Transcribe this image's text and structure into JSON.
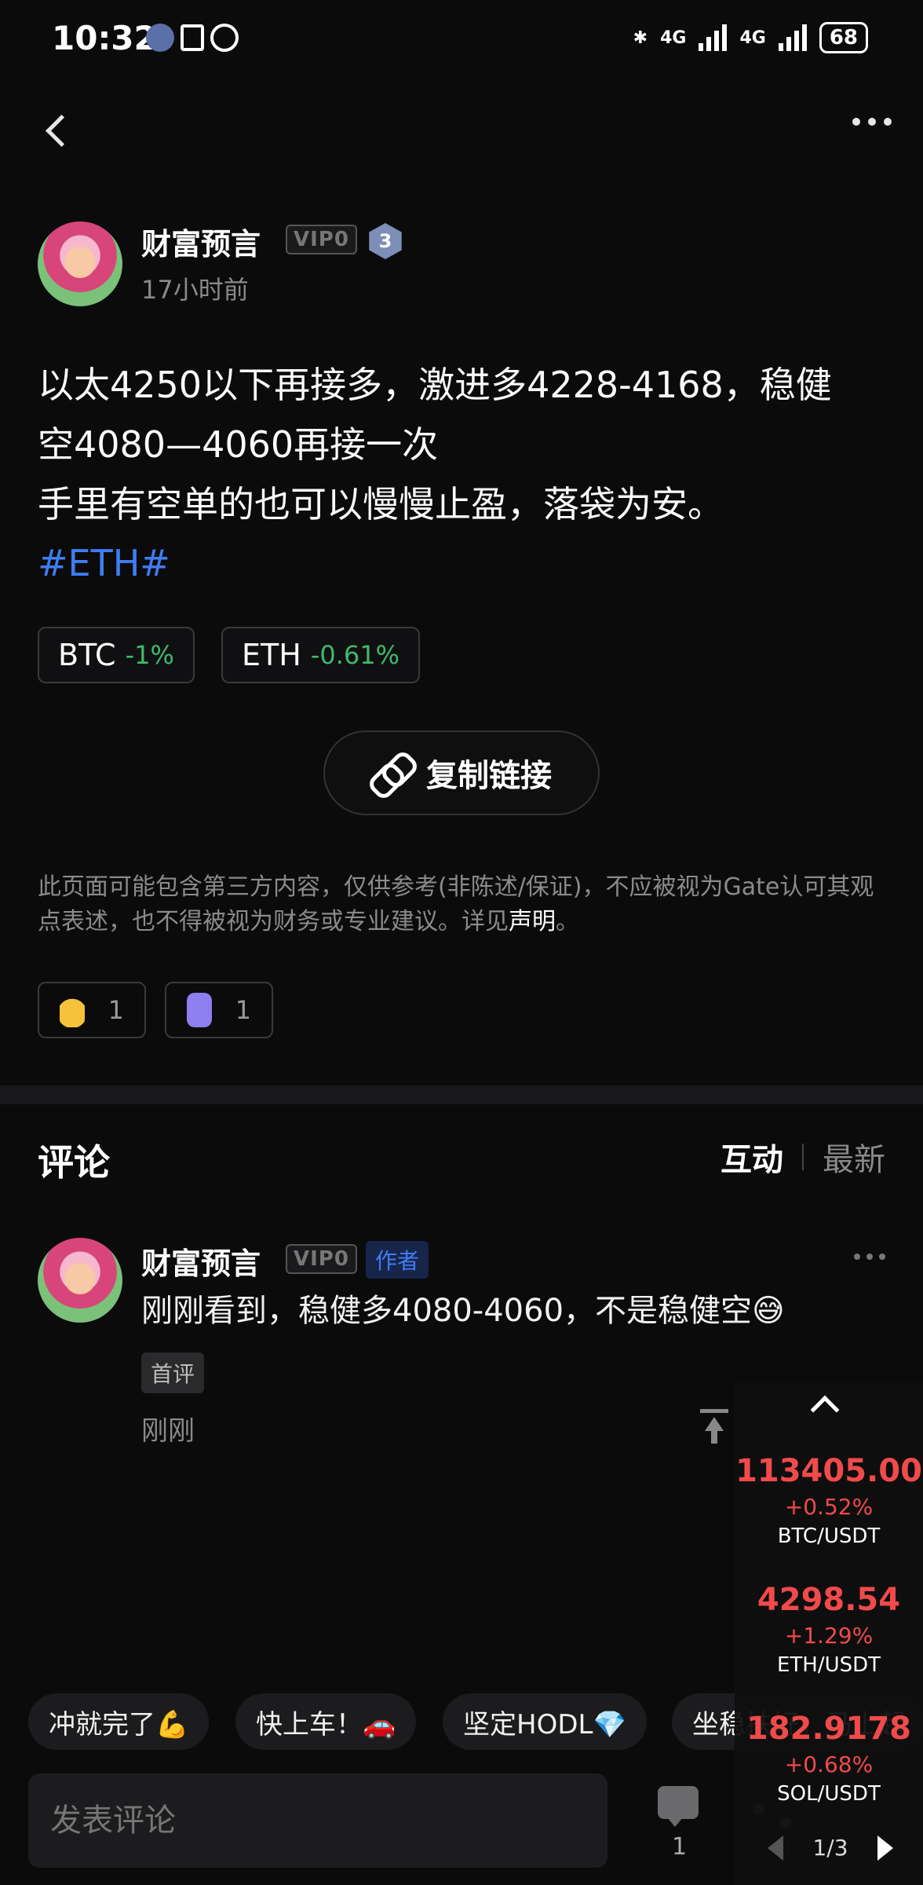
{
  "status_bar": {
    "time": "10:32",
    "battery": "68",
    "net1": "4G",
    "net2": "4G"
  },
  "post": {
    "author": "财富预言",
    "vip": "VIP0",
    "level": "3",
    "time": "17小时前",
    "text_line1": "以太4250以下再接多，激进多4228-4168，稳健",
    "text_line2": "空4080—4060再接一次",
    "text_line3": "手里有空单的也可以慢慢止盈，落袋为安。",
    "hashtag": "#ETH#",
    "chips": [
      {
        "symbol": "BTC",
        "change": "-1%"
      },
      {
        "symbol": "ETH",
        "change": "-0.61%"
      }
    ],
    "copy_link": "复制链接",
    "disclaimer_main": "此页面可能包含第三方内容，仅供参考(非陈述/保证)，不应被视为Gate认可其观点表述，也不得被视为财务或专业建议。详见",
    "disclaimer_link": "声明",
    "disclaimer_end": "。",
    "reactions": [
      {
        "emoji": "thumbs-up",
        "count": "1"
      },
      {
        "emoji": "ghost",
        "count": "1"
      }
    ]
  },
  "comments": {
    "title": "评论",
    "sort_active": "互动",
    "sort_other": "最新",
    "items": [
      {
        "author": "财富预言",
        "vip": "VIP0",
        "badge": "作者",
        "text": "刚刚看到，稳健多4080-4060，不是稳健空😅",
        "tag": "首评",
        "time": "刚刚"
      }
    ]
  },
  "quick_replies": [
    "冲就完了💪",
    "快上车！🚗",
    "坚定HODL💎",
    "坐稳扶好，马上起"
  ],
  "bottom_bar": {
    "placeholder": "发表评论",
    "comment_count": "1"
  },
  "ticker": {
    "items": [
      {
        "price": "113405.00",
        "change": "+0.52%",
        "pair": "BTC/USDT"
      },
      {
        "price": "4298.54",
        "change": "+1.29%",
        "pair": "ETH/USDT"
      },
      {
        "price": "182.9178",
        "change": "+0.68%",
        "pair": "SOL/USDT"
      }
    ],
    "page": "1/3"
  },
  "colors": {
    "accent_blue": "#3f7df4",
    "up_red": "#f04a4a",
    "down_green": "#3fb96b"
  }
}
